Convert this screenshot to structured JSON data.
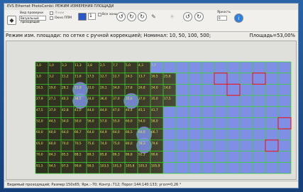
{
  "window": {
    "title": "EVS Ethernet PhotoCombi: РЕЖИМ ИЗМЕРЕНИЯ ПЛОЩАДИ"
  },
  "toolbar": {
    "check_type_label": "Вид проверки",
    "check_type_value": "Визуальный проходящий",
    "checkbox_lines_label": "Лінии",
    "checkbox_pnp_label": "Окно ППМ",
    "zones_value": "1",
    "all_zones_label": "Все зоны",
    "brightness_label": "Яркость",
    "brightness_value": "0"
  },
  "info": {
    "mode_text": "Режим изм. площади: по сетке с ручной коррекцией; Номинал: 10, 50, 100, 500;",
    "area_text": "Площадь=53,00%"
  },
  "grid": {
    "columns": 20,
    "rows": 10,
    "values": [
      [
        "1,0",
        "1,0",
        "3,3",
        "11,3",
        "2,8",
        "2,5",
        "7,7",
        "5,0",
        "4,3",
        "7,7"
      ],
      [
        "1,0",
        "3,2",
        "11,2",
        "11,6",
        "17,5",
        "12,7",
        "12,7",
        "24,5",
        "13,7",
        "16,5",
        "25,6"
      ],
      [
        "10,5",
        "19,0",
        "28,1",
        "21,8",
        "33,0",
        "20,1",
        "34,0",
        "27,8",
        "26,8",
        "34,0",
        "14,0"
      ],
      [
        "27,9",
        "27,1",
        "40,3",
        "38,5",
        "34,0",
        "36,0",
        "37,0",
        "35,0",
        "37,0",
        "35,0",
        "17,5"
      ],
      [
        "47,5",
        "37,0",
        "42,8",
        "41,0",
        "44,0",
        "44,0",
        "47,0",
        "40,4",
        "45,1",
        "41,7"
      ],
      [
        "52,0",
        "44,5",
        "54,0",
        "50,0",
        "56,0",
        "57,0",
        "55,0",
        "60,0",
        "54,0",
        "58,0"
      ],
      [
        "60,0",
        "60,0",
        "64,0",
        "66,7",
        "64,0",
        "64,9",
        "64,0",
        "66,5",
        "64,0",
        "66,7"
      ],
      [
        "65,0",
        "60,0",
        "70,0",
        "70,5",
        "75,6",
        "74,0",
        "75,0",
        "80,0",
        "78,3",
        "79,6"
      ],
      [
        "70,0",
        "84,3",
        "85,5",
        "88,5",
        "89,3",
        "85,8",
        "86,3",
        "86,8",
        "92,3",
        "90,6"
      ],
      [
        "91,5",
        "94,5",
        "97,5",
        "99,6",
        "99,5",
        "103,5",
        "101,5",
        "105,8",
        "105,5",
        "105,9"
      ]
    ],
    "highlighted_cells": [
      [
        1,
        14
      ],
      [
        1,
        17
      ],
      [
        2,
        15
      ],
      [
        5,
        19
      ],
      [
        7,
        18
      ]
    ],
    "colors": {
      "grid_line": "#39d42b",
      "covered_fill": "#7f8fe6",
      "highlight_border": "#e0222a",
      "cell_text": "#e8e85a"
    }
  },
  "status": {
    "text": "Видимый проходящий;  Размер:150х65;  Ярк.:-70;  Контр.:712;  Порог:144:140:133;  угол=0,26 °"
  }
}
